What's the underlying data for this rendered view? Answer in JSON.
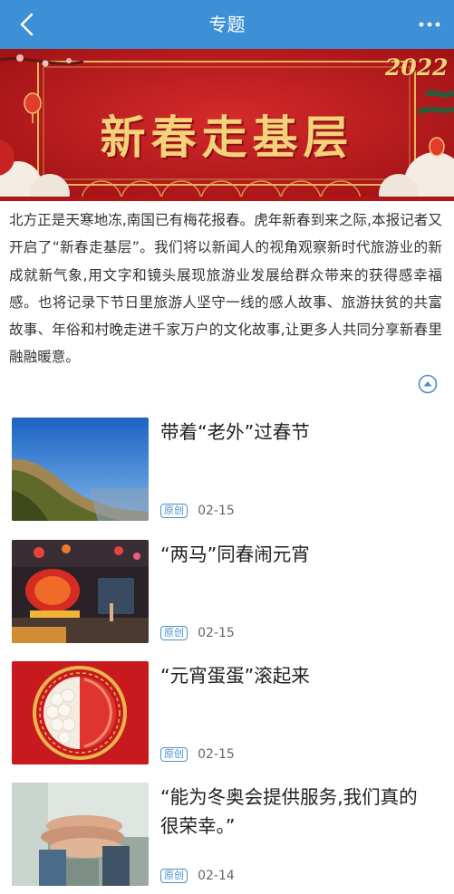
{
  "header": {
    "title": "专题",
    "back_icon": "chevron-left-icon",
    "more_icon": "more-horizontal-icon",
    "bg_color": "#3d8fd6"
  },
  "banner": {
    "title": "新春走基层",
    "year": "2022",
    "bg_color": "#b8191c",
    "text_color": "#f6d27a"
  },
  "intro": {
    "text": "北方正是天寒地冻,南国已有梅花报春。虎年新春到来之际,本报记者又开启了“新春走基层”。我们将以新闻人的视角观察新时代旅游业的新成就新气象,用文字和镜头展现旅游业发展给群众带来的获得感幸福感。也将记录下节日里旅游人坚守一线的感人故事、旅游扶贫的共富故事、年俗和村晚走进千家万户的文化故事,让更多人共同分享新春里融融暖意。",
    "collapse_icon": "chevron-up-circle-icon"
  },
  "articles": [
    {
      "title": "带着“老外”过春节",
      "badge": "原创",
      "date": "02-15",
      "thumb": "mountain-landscape-photo"
    },
    {
      "title": "“两马”同春闹元宵",
      "badge": "原创",
      "date": "02-15",
      "thumb": "lantern-night-photo"
    },
    {
      "title": "“元宵蛋蛋”滚起来",
      "badge": "原创",
      "date": "02-15",
      "thumb": "tangyuan-bowl-photo"
    },
    {
      "title": "“能为冬奥会提供服务,我们真的很荣幸。”",
      "badge": "原创",
      "date": "02-14",
      "thumb": "stacked-hands-photo"
    }
  ],
  "accent_color": "#4a8fcf"
}
